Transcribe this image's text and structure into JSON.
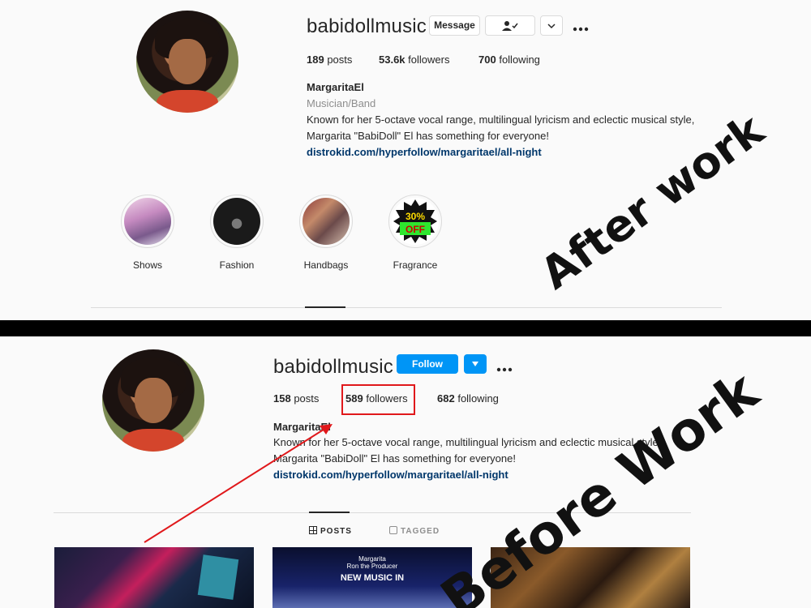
{
  "after": {
    "username": "babidollmusic",
    "buttons": {
      "message": "Message",
      "follow_status_icon": "person-check-icon",
      "dropdown_icon": "chevron-down-icon",
      "more_icon": "more-dots-icon"
    },
    "stats": {
      "posts_count": "189",
      "posts_label": "posts",
      "followers_count": "53.6k",
      "followers_label": "followers",
      "following_count": "700",
      "following_label": "following"
    },
    "name": "MargaritaEl",
    "category": "Musician/Band",
    "bio_line1": "Known for her 5-octave vocal range, multilingual lyricism and eclectic musical style,",
    "bio_line2": "Margarita \"BabiDoll\" El has something for everyone!",
    "link": "distrokid.com/hyperfollow/margaritael/all-night",
    "highlights": [
      {
        "label": "Shows"
      },
      {
        "label": "Fashion"
      },
      {
        "label": "Handbags"
      },
      {
        "label": "Fragrance",
        "badge_text": "30%",
        "badge_sub": "OFF"
      }
    ]
  },
  "before": {
    "username": "babidollmusic",
    "buttons": {
      "follow": "Follow",
      "dropdown_icon": "caret-down-icon",
      "more_icon": "more-dots-icon"
    },
    "stats": {
      "posts_count": "158",
      "posts_label": "posts",
      "followers_count": "589",
      "followers_label": "followers",
      "following_count": "682",
      "following_label": "following"
    },
    "name": "MargaritaEl",
    "bio_line1": "Known for her 5-octave vocal range, multilingual lyricism and eclectic musical style,",
    "bio_line2": "Margarita \"BabiDoll\" El has something for everyone!",
    "link": "distrokid.com/hyperfollow/margaritael/all-night",
    "tabs": {
      "posts": "POSTS",
      "tagged": "TAGGED"
    },
    "posts": [
      {
        "caption": ""
      },
      {
        "top": "Margarita",
        "mid": "Ron the Producer",
        "title": "NEW MUSIC IN"
      },
      {
        "caption": ""
      }
    ]
  },
  "overlays": {
    "after_text": "After work",
    "before_text": "Before Work"
  },
  "colors": {
    "follow_blue": "#0095f6",
    "highlight_box": "#e0181b",
    "link_blue": "#00376b",
    "divider": "#000000"
  }
}
